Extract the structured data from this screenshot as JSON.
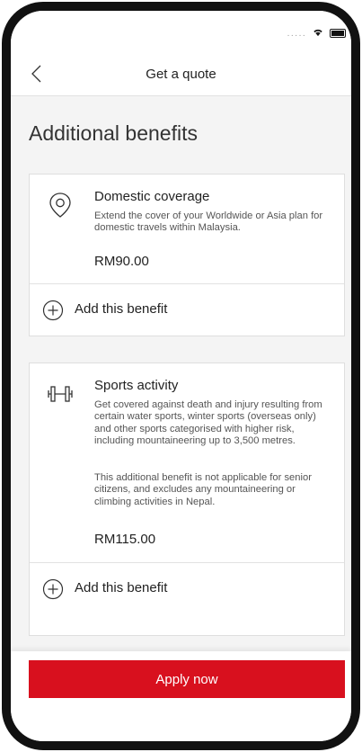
{
  "header": {
    "title": "Get a quote"
  },
  "section": {
    "title": "Additional benefits"
  },
  "benefits": [
    {
      "title": "Domestic coverage",
      "description": [
        "Extend the cover of your Worldwide or Asia plan for domestic travels within Malaysia."
      ],
      "price": "RM90.00",
      "add_label": "Add this benefit",
      "icon": "location-pin-icon"
    },
    {
      "title": "Sports activity",
      "description": [
        "Get covered against death and injury resulting from certain water sports, winter sports (overseas only) and other sports categorised with higher risk, including mountaineering up to 3,500 metres.",
        "This additional benefit is not applicable for senior citizens, and excludes any mountaineering or climbing activities in Nepal."
      ],
      "price": "RM115.00",
      "add_label": "Add this benefit",
      "icon": "dumbbell-icon"
    }
  ],
  "footer": {
    "apply_label": "Apply now"
  },
  "colors": {
    "accent": "#d8101e"
  }
}
